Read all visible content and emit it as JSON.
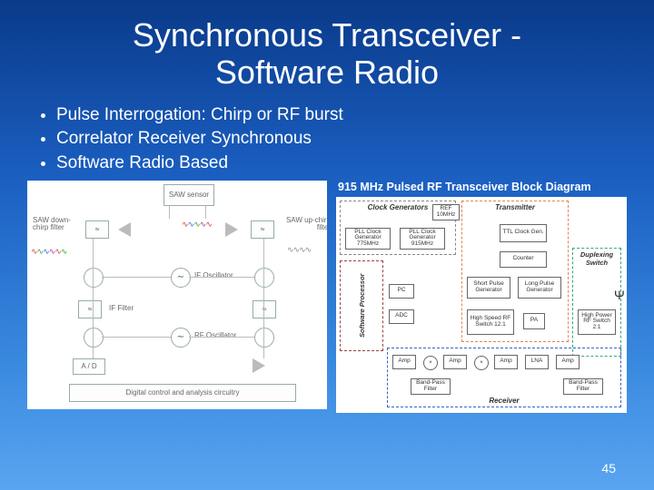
{
  "title_line1": "Synchronous Transceiver -",
  "title_line2": "Software Radio",
  "bullets": [
    "Pulse Interrogation: Chirp or RF burst",
    "Correlator Receiver  Synchronous",
    "Software Radio Based"
  ],
  "right_caption": "915 MHz Pulsed RF Transceiver Block Diagram",
  "page_number": "45",
  "left_diagram": {
    "saw_sensor": "SAW sensor",
    "saw_downchirp": "SAW down-chirp filter",
    "saw_upchirp": "SAW up-chirp filter",
    "if_oscillator": "IF Oscillator",
    "if_filter": "IF Filter",
    "rf_oscillator": "RF Oscillator",
    "ad": "A / D",
    "bottom_bar": "Digital control and analysis circuitry"
  },
  "right_diagram": {
    "sections": {
      "clock": "Clock Generators",
      "transmitter": "Transmitter",
      "duplex": "Duplexing Switch",
      "software": "Software Processor",
      "receiver": "Receiver"
    },
    "blocks": {
      "ref": "REF 10MHz",
      "pll_775": "PLL Clock Generator 775MHz",
      "pll_915": "PLL Clock Generator 915MHz",
      "ttl": "TTL Clock Gen.",
      "counter": "Counter",
      "short_pulse": "Short Pulse Generator",
      "long_pulse": "Long Pulse Generator",
      "hs_switch": "High Speed RF Switch 12:1",
      "pa": "PA",
      "hp_switch": "High Power RF Switch 2:1",
      "pc": "PC",
      "adc": "ADC",
      "amp": "Amp",
      "lna": "LNA",
      "bandpass": "Band-Pass Filter",
      "mix": "×"
    }
  }
}
